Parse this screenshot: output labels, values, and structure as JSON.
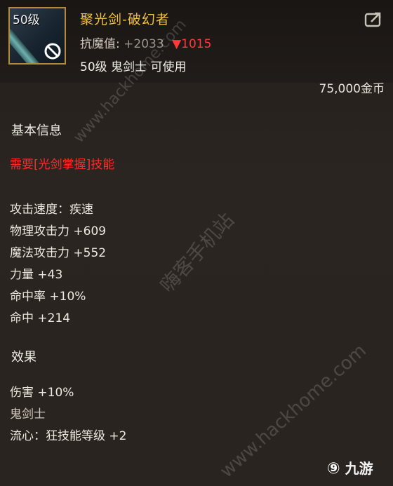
{
  "item": {
    "icon_level": "50级",
    "name": "聚光剑-破幻者",
    "stat_label": "抗魔值:",
    "stat_value": "+2033",
    "stat_diff": "▼1015",
    "requirement": "50级 鬼剑士 可使用",
    "price": "75,000金币"
  },
  "basic": {
    "title": "基本信息",
    "skill_requirement": "需要[光剑掌握]技能",
    "stats": [
      "攻击速度：疾速",
      "物理攻击力 +609",
      "魔法攻击力 +552",
      "力量 +43",
      "命中率 +10%",
      "命中 +214"
    ]
  },
  "effect": {
    "title": "效果",
    "lines": [
      "伤害 +10%",
      "鬼剑士",
      "流心：狂技能等级 +2"
    ]
  },
  "watermarks": {
    "cn": "嗨客手机站",
    "url_top": "www.hackhome.com",
    "url_bottom": "www.hackhome.com"
  },
  "logo": "九游",
  "colors": {
    "name_gold": "#f1c040",
    "diff_red": "#ff3a3a",
    "requirement_red": "#ff2a2a"
  }
}
